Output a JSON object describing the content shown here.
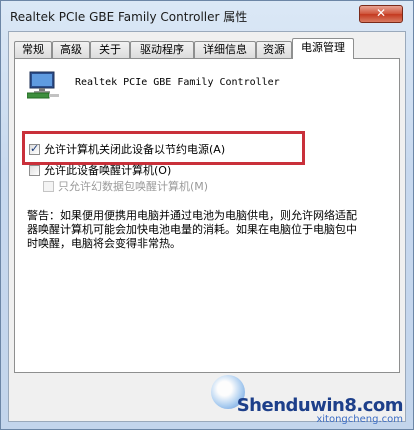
{
  "window": {
    "title": "Realtek PCIe GBE Family Controller 属性",
    "close_label": "✕"
  },
  "tabs": [
    {
      "label": "常规",
      "active": false
    },
    {
      "label": "高级",
      "active": false
    },
    {
      "label": "关于",
      "active": false
    },
    {
      "label": "驱动程序",
      "active": false
    },
    {
      "label": "详细信息",
      "active": false
    },
    {
      "label": "资源",
      "active": false
    },
    {
      "label": "电源管理",
      "active": true
    }
  ],
  "device": {
    "name": "Realtek PCIe GBE Family Controller",
    "icon": "network-adapter-icon"
  },
  "options": {
    "allow_turn_off": {
      "label": "允许计算机关闭此设备以节约电源(A)",
      "checked": true
    },
    "allow_wake": {
      "label": "允许此设备唤醒计算机(O)",
      "checked": false
    },
    "magic_packet_only": {
      "label": "只允许幻数据包唤醒计算机(M)",
      "checked": false,
      "disabled": true
    }
  },
  "warning_text": "警告：如果便用便携用电脑并通过电池为电脑供电，则允许网络适配器唤醒计算机可能会加快电池电量的消耗。如果在电脑位于电脑包中时唤醒，电脑将会变得非常热。",
  "watermark": {
    "main": "Shenduwin8.com",
    "sub": "xitongcheng.com"
  },
  "colors": {
    "highlight_border": "#c9303a",
    "close_button": "#c4391f"
  }
}
